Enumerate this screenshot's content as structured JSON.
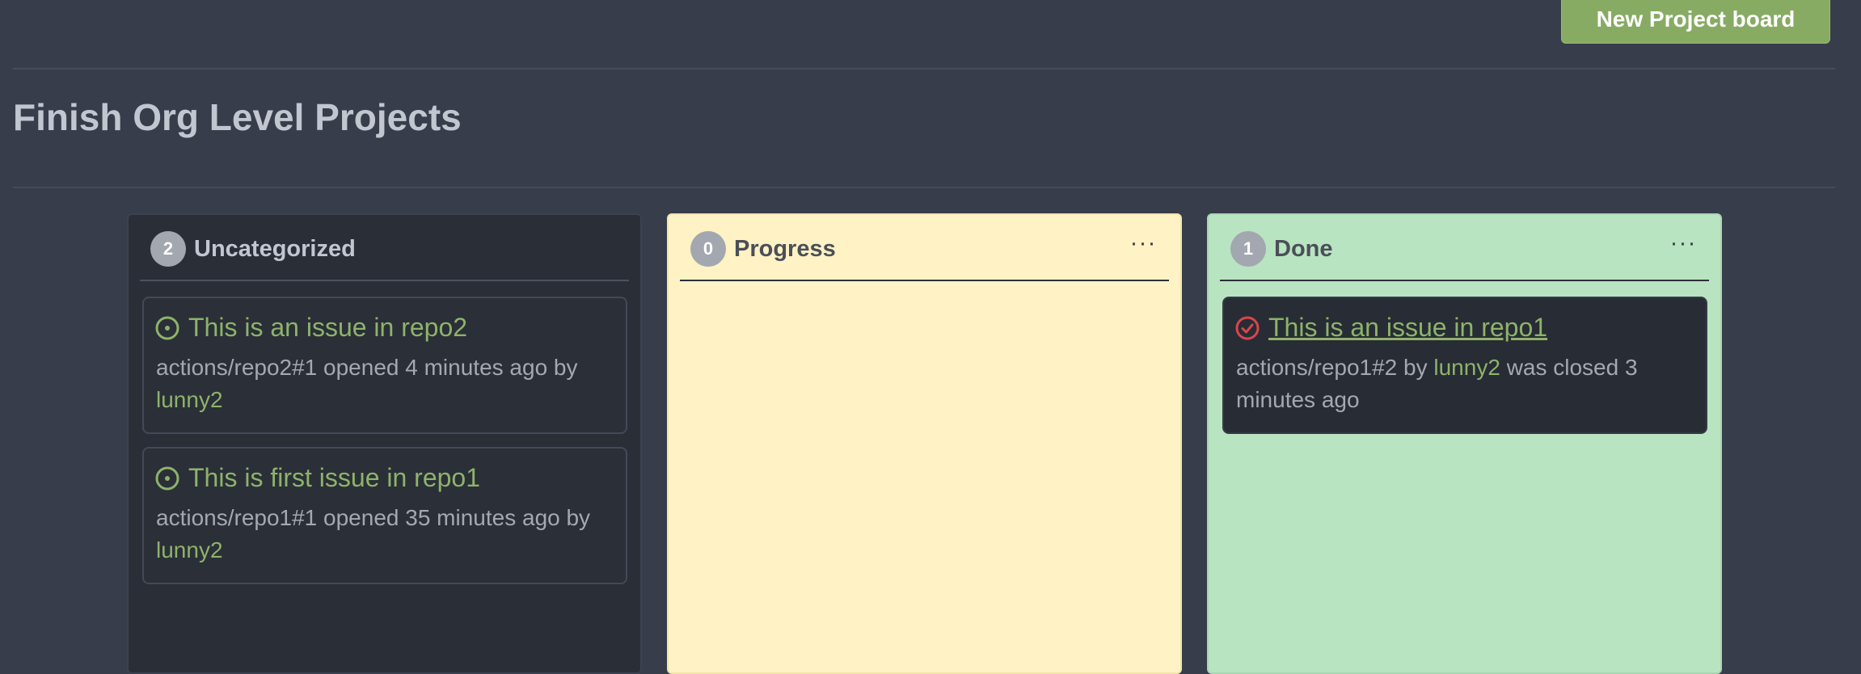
{
  "header": {
    "new_board_label": "New Project board"
  },
  "page": {
    "title": "Finish Org Level Projects"
  },
  "columns": [
    {
      "count": "2",
      "title": "Uncategorized",
      "cards": [
        {
          "title": "This is an issue in repo2",
          "meta": "actions/repo2#1 opened 4 minutes ago by",
          "user": "lunny2",
          "state": "open"
        },
        {
          "title": "This is first issue in repo1",
          "meta": "actions/repo1#1 opened 35 minutes ago by",
          "user": "lunny2",
          "state": "open"
        }
      ]
    },
    {
      "count": "0",
      "title": "Progress",
      "menu": "···",
      "cards": []
    },
    {
      "count": "1",
      "title": "Done",
      "menu": "···",
      "cards": [
        {
          "title": "This is an issue in repo1",
          "meta_prefix": "actions/repo1#2 by",
          "user": "lunny2",
          "meta_suffix": "was closed 3 minutes ago",
          "state": "closed"
        }
      ]
    }
  ],
  "colors": {
    "background": "#373d4a",
    "accent_green": "#87ab63",
    "link_green": "#8db36a",
    "progress_column": "#fff2c4",
    "done_column": "#b9e4c1",
    "closed_red": "#d9464c"
  },
  "icons": {
    "open_issue": "issue-opened-icon",
    "closed_issue": "issue-closed-icon",
    "menu": "kebab-menu-icon"
  }
}
